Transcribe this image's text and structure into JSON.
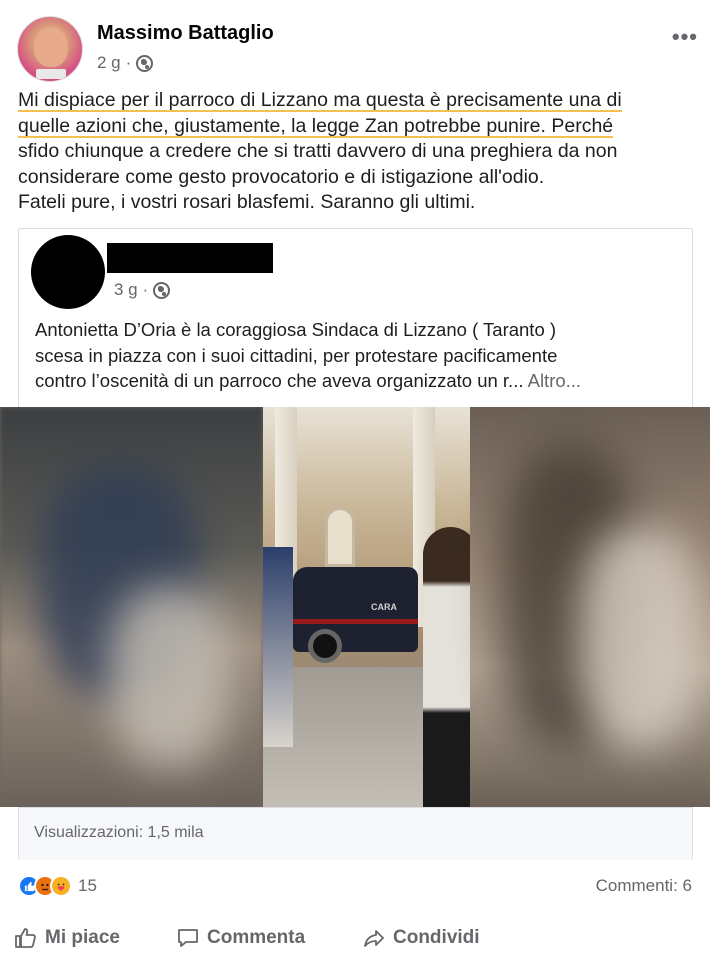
{
  "post": {
    "author": "Massimo Battaglio",
    "time": "2 g",
    "more_icon": "more-horizontal-icon",
    "privacy_icon": "globe-icon",
    "text_lines": [
      "Mi dispiace per il parroco di Lizzano ma questa è precisamente una di",
      "quelle azioni che, giustamente, la legge Zan potrebbe punire. Perché",
      "sfido chiunque a credere che si tratti davvero di una preghiera da non",
      "considerare come gesto provocatorio e di istigazione all'odio.",
      "Fateli pure, i vostri rosari blasfemi. Saranno gli ultimi."
    ],
    "highlight_color": "#f4c14f"
  },
  "shared": {
    "time": "3 g",
    "privacy_icon": "globe-icon",
    "text_lines": [
      "Antonietta D’Oria è la coraggiosa Sindaca di Lizzano ( Taranto )",
      "scesa in piazza con i suoi cittadini,  per protestare pacificamente",
      "contro l’oscenità di un parroco che aveva organizzato un r..."
    ],
    "more_link": "Altro...",
    "video_car_label": "CARA",
    "views": "Visualizzazioni: 1,5 mila"
  },
  "footer": {
    "reaction_icons": [
      "like-reaction-icon",
      "angry-reaction-icon",
      "care-reaction-icon"
    ],
    "reaction_count": "15",
    "comments": "Commenti: 6",
    "actions": {
      "like": "Mi piace",
      "comment": "Commenta",
      "share": "Condividi"
    }
  },
  "colors": {
    "accent": "#1877f2",
    "secondary_text": "#65676b"
  }
}
